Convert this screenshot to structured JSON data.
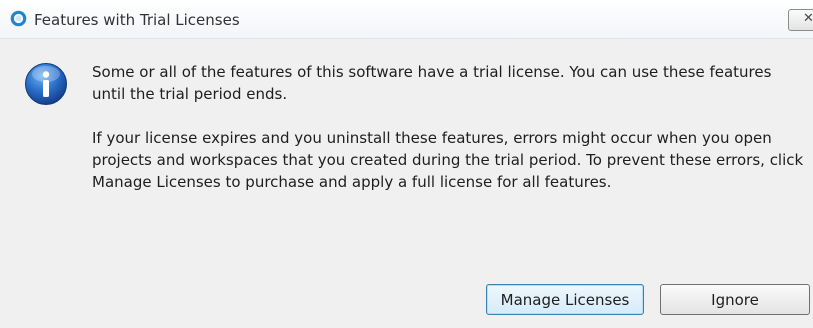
{
  "window": {
    "title": "Features with Trial Licenses",
    "title_icon": "ring-icon",
    "close_glyph": "✕"
  },
  "dialog": {
    "icon": "information-icon",
    "paragraph1": "Some or all of the features of this software have a trial license.  You can use these features until the trial period ends.",
    "paragraph2": "If your license expires and you uninstall these features, errors might occur when you open projects and workspaces that you created during the trial period.  To prevent these errors, click Manage Licenses to purchase and apply a full license for all features."
  },
  "buttons": {
    "manage_label": "Manage Licenses",
    "ignore_label": "Ignore"
  },
  "colors": {
    "accent": "#2a8fd8",
    "background": "#f0f0f0",
    "info_blue": "#1c5fb8"
  }
}
